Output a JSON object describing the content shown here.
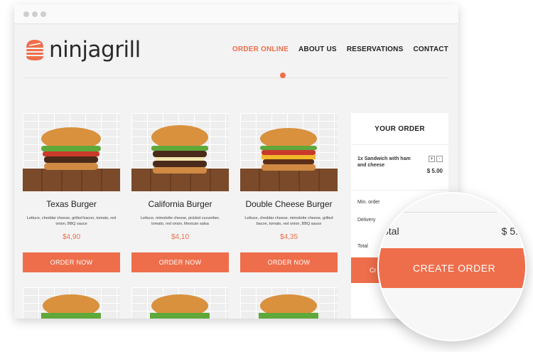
{
  "brand": {
    "name": "ninjagrill",
    "accent": "#ee6e4b"
  },
  "nav": {
    "items": [
      {
        "label": "ORDER ONLINE",
        "active": true
      },
      {
        "label": "ABOUT US"
      },
      {
        "label": "RESERVATIONS"
      },
      {
        "label": "CONTACT"
      }
    ]
  },
  "products": [
    {
      "name": "Texas Burger",
      "description": "Lettuce, cheddar cheese, grilled bacon, tomato, red onion, BBQ sauce",
      "price": "$4,90",
      "button": "ORDER NOW"
    },
    {
      "name": "California Burger",
      "description": "Lettuce, mimolette cheese, pickled cucumber, tomato, red onion, Mexican salsa",
      "price": "$4,10",
      "button": "ORDER NOW"
    },
    {
      "name": "Double Cheese Burger",
      "description": "Lettuce, cheddar cheese, mimolette cheese, grilled bacon, tomato, red onion, BBQ sauce",
      "price": "$4,35",
      "button": "ORDER NOW"
    }
  ],
  "order": {
    "title": "YOUR ORDER",
    "item": "1x Sandwich with ham and cheese",
    "item_price": "$ 5.00",
    "plus": "+",
    "minus": "-",
    "min_order_label": "Min. order",
    "delivery_label": "Delivery",
    "total_label": "Total",
    "button_partial": "Cr"
  },
  "magnifier": {
    "total_label": "otal",
    "total_value": "$ 5.",
    "button": "CREATE ORDER"
  }
}
